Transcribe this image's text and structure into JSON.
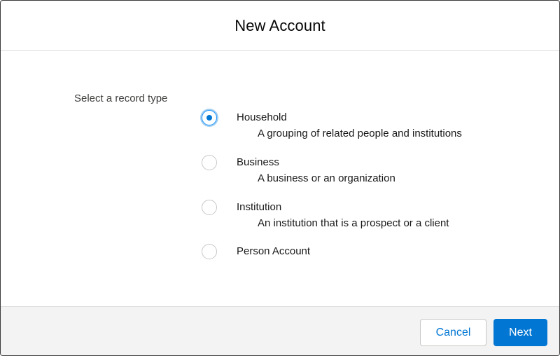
{
  "modal": {
    "title": "New Account"
  },
  "record_type": {
    "prompt": "Select a record type",
    "selected": "Household",
    "options": [
      {
        "label": "Household",
        "description": "A grouping of related people and institutions",
        "checked": true
      },
      {
        "label": "Business",
        "description": "A business or an organization",
        "checked": false
      },
      {
        "label": "Institution",
        "description": "An institution that is a prospect or a client",
        "checked": false
      },
      {
        "label": "Person Account",
        "description": "",
        "checked": false
      }
    ]
  },
  "footer": {
    "cancel_label": "Cancel",
    "next_label": "Next"
  },
  "colors": {
    "brand": "#0176d3",
    "footer_bg": "#f3f3f3",
    "border": "#dddbda"
  }
}
